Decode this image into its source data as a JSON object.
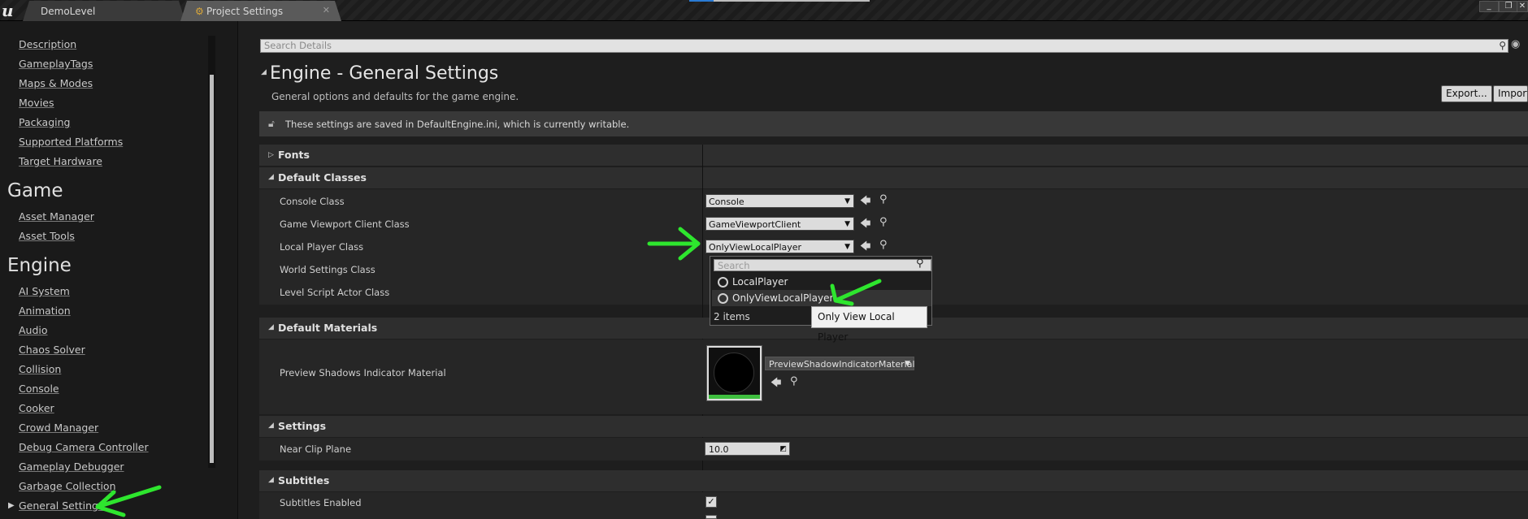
{
  "titlebar": {
    "tabs": [
      {
        "label": "DemoLevel"
      },
      {
        "label": "Project Settings"
      }
    ],
    "window_buttons": [
      "_",
      "❐",
      "✕"
    ]
  },
  "nav": {
    "project_items": [
      "Description",
      "GameplayTags",
      "Maps & Modes",
      "Movies",
      "Packaging",
      "Supported Platforms",
      "Target Hardware"
    ],
    "game_heading": "Game",
    "game_items": [
      "Asset Manager",
      "Asset Tools"
    ],
    "engine_heading": "Engine",
    "engine_items": [
      "AI System",
      "Animation",
      "Audio",
      "Chaos Solver",
      "Collision",
      "Console",
      "Cooker",
      "Crowd Manager",
      "Debug Camera Controller",
      "Gameplay Debugger",
      "Garbage Collection",
      "General Settings"
    ]
  },
  "search": {
    "placeholder": "Search Details"
  },
  "header": {
    "title": "Engine - General Settings",
    "subtitle": "General options and defaults for the game engine.",
    "export_label": "Export...",
    "import_label": "Import..."
  },
  "saved_notice": "These settings are saved in DefaultEngine.ini, which is currently writable.",
  "categories": {
    "fonts": "Fonts",
    "default_classes": "Default Classes",
    "default_materials": "Default Materials",
    "settings": "Settings",
    "subtitles": "Subtitles"
  },
  "default_classes": {
    "console_class": {
      "label": "Console Class",
      "value": "Console"
    },
    "game_viewport": {
      "label": "Game Viewport Client Class",
      "value": "GameViewportClient"
    },
    "local_player": {
      "label": "Local Player Class",
      "value": "OnlyViewLocalPlayer"
    },
    "world_settings": {
      "label": "World Settings Class"
    },
    "level_script": {
      "label": "Level Script Actor Class"
    }
  },
  "dropdown": {
    "search_placeholder": "Search",
    "items": [
      "LocalPlayer",
      "OnlyViewLocalPlayer"
    ],
    "count": "2 items",
    "tooltip": "Only View Local Player"
  },
  "default_materials": {
    "preview_shadows": {
      "label": "Preview Shadows Indicator Material",
      "value": "PreviewShadowIndicatorMaterial"
    }
  },
  "settings": {
    "near_clip": {
      "label": "Near Clip Plane",
      "value": "10.0"
    }
  },
  "subtitles": {
    "enabled": {
      "label": "Subtitles Enabled",
      "checked": true
    }
  },
  "colors": {
    "annotation_green": "#2ee62e",
    "accent_blue": "#2a7bd4"
  }
}
